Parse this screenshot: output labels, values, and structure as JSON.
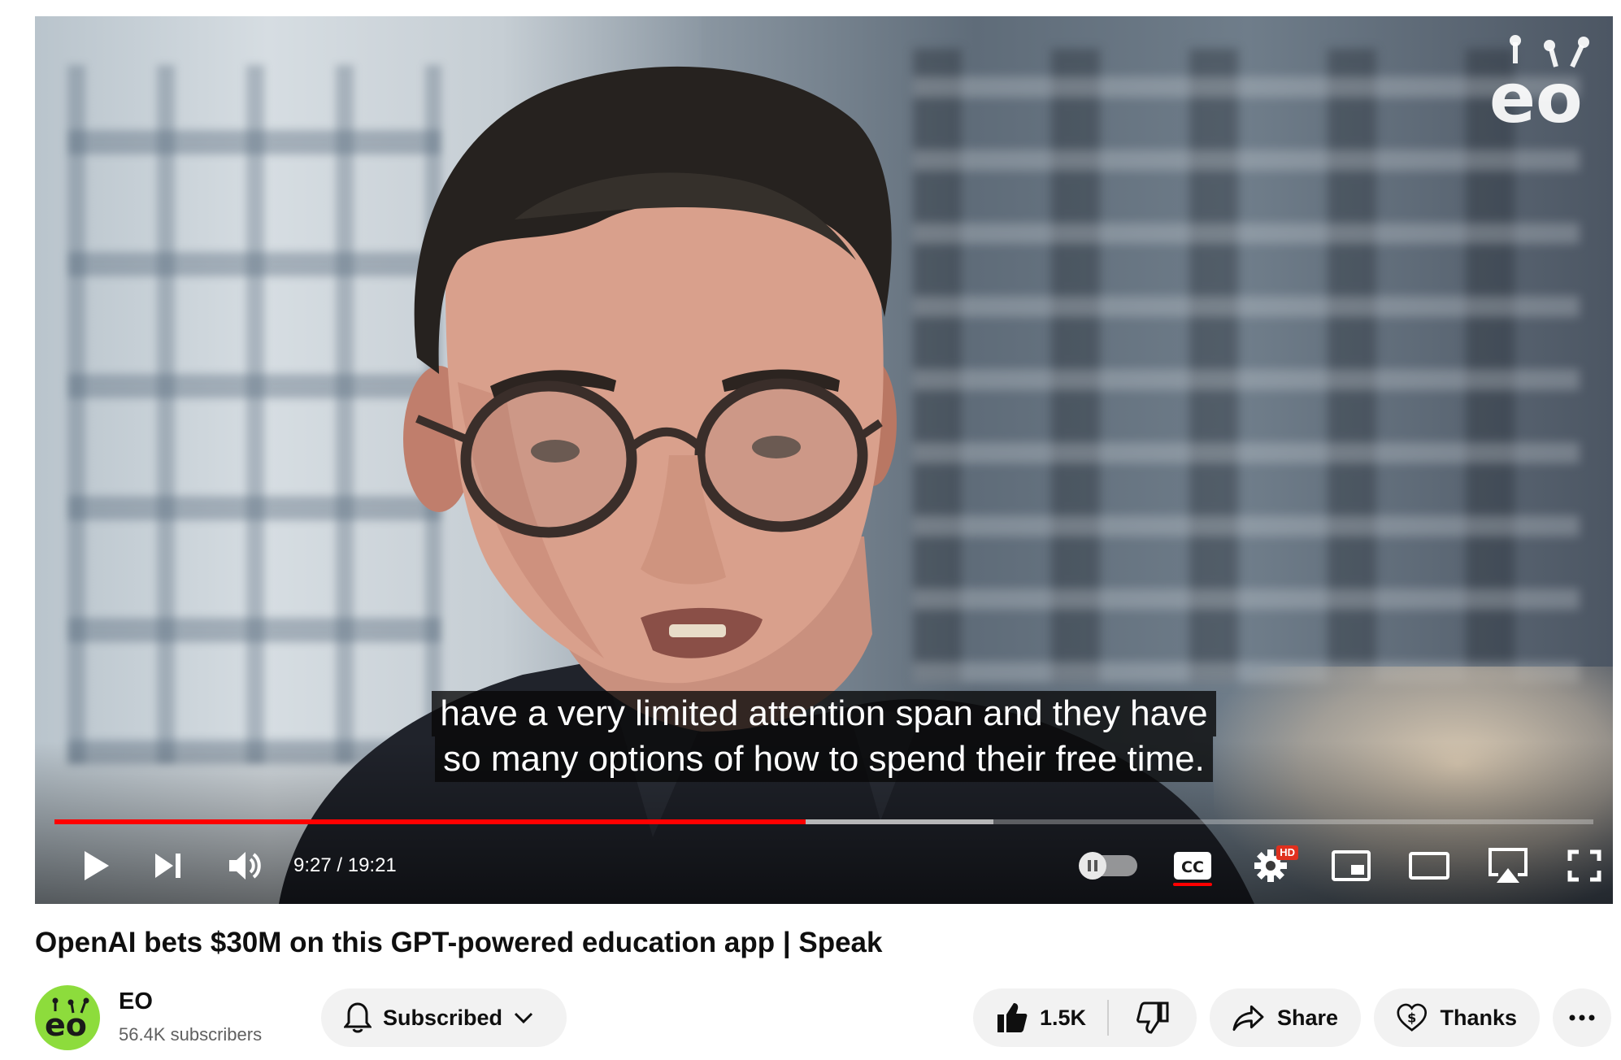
{
  "player": {
    "watermark_icon": "eo-logo",
    "captions": [
      "have a very limited attention span and they have",
      "so many options of how to spend their free time."
    ],
    "time": "9:27 / 19:21",
    "progress_played_fraction": 0.488,
    "progress_loaded_fraction": 0.61,
    "hd_badge": "HD",
    "colors": {
      "progress": "#ff0000",
      "hd_badge": "#e0301e"
    },
    "controls": [
      "play-icon",
      "next-icon",
      "volume-icon",
      "autoplay-toggle",
      "cc-icon",
      "settings-icon",
      "miniplayer-icon",
      "theater-icon",
      "airplay-icon",
      "fullscreen-icon"
    ]
  },
  "video": {
    "title": "OpenAI bets $30M on this GPT-powered education app | Speak"
  },
  "channel": {
    "name": "EO",
    "subscribers": "56.4K subscribers",
    "avatar_color": "#8ddc3c"
  },
  "actions": {
    "subscribe_label": "Subscribed",
    "like_count": "1.5K",
    "share_label": "Share",
    "thanks_label": "Thanks"
  }
}
